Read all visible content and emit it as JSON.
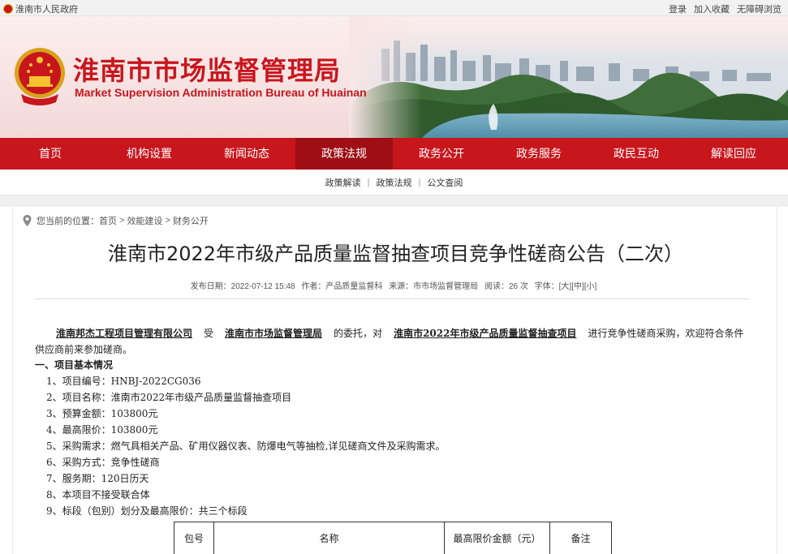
{
  "topbar": {
    "gov_name": "淮南市人民政府",
    "links": [
      "登录",
      "加入收藏",
      "无障碍浏览"
    ]
  },
  "banner": {
    "title_cn": "淮南市市场监督管理局",
    "title_en": "Market Supervision Administration Bureau of Huainan"
  },
  "nav": {
    "items": [
      "首页",
      "机构设置",
      "新闻动态",
      "政策法规",
      "政务公开",
      "政务服务",
      "政民互动",
      "解读回应"
    ],
    "active": "政策法规"
  },
  "subnav": {
    "items": [
      "政策解读",
      "政策法规",
      "公文查阅"
    ],
    "separator": "|"
  },
  "breadcrumb": {
    "prefix": "您当前的位置：",
    "items": [
      "首页",
      "效能建设",
      "财务公开"
    ],
    "arrow": ">"
  },
  "article": {
    "title": "淮南市2022年市级产品质量监督抽查项目竞争性磋商公告（二次）",
    "meta": {
      "date": "发布日期：2022-07-12 15:48",
      "author": "作者：产品质量监督科",
      "source": "来源：市市场监督管理局",
      "views": "阅读：26 次",
      "font_label": "字体：",
      "sizes": [
        "[大]",
        "[中]",
        "[小]"
      ]
    },
    "intro": {
      "agent": "淮南邦杰工程项目管理有限公司",
      "by": "受",
      "client": "淮南市市场监督管理局",
      "entrust": "的委托，对",
      "project": "淮南市2022年市级产品质量监督抽查项目",
      "rest": "进行竞争性磋商采购，欢迎符合条件供应商前来参加磋商。"
    },
    "section1": "一、项目基本情况",
    "lines": [
      "1、项目编号：HNBJ-2022CG036",
      "2、项目名称：淮南市2022年市级产品质量监督抽查项目",
      "3、预算金额：103800元",
      "4、最高限价：103800元",
      "5、采购需求：燃气具相关产品、矿用仪器仪表、防爆电气等抽检,详见磋商文件及采购需求。",
      "6、采购方式：竞争性磋商",
      "7、服务期：120日历天",
      "8、本项目不接受联合体",
      "9、标段（包别）划分及最高限价：共三个标段"
    ],
    "table_headers": [
      "包号",
      "名称",
      "最高限价金额（元）",
      "备注"
    ]
  }
}
